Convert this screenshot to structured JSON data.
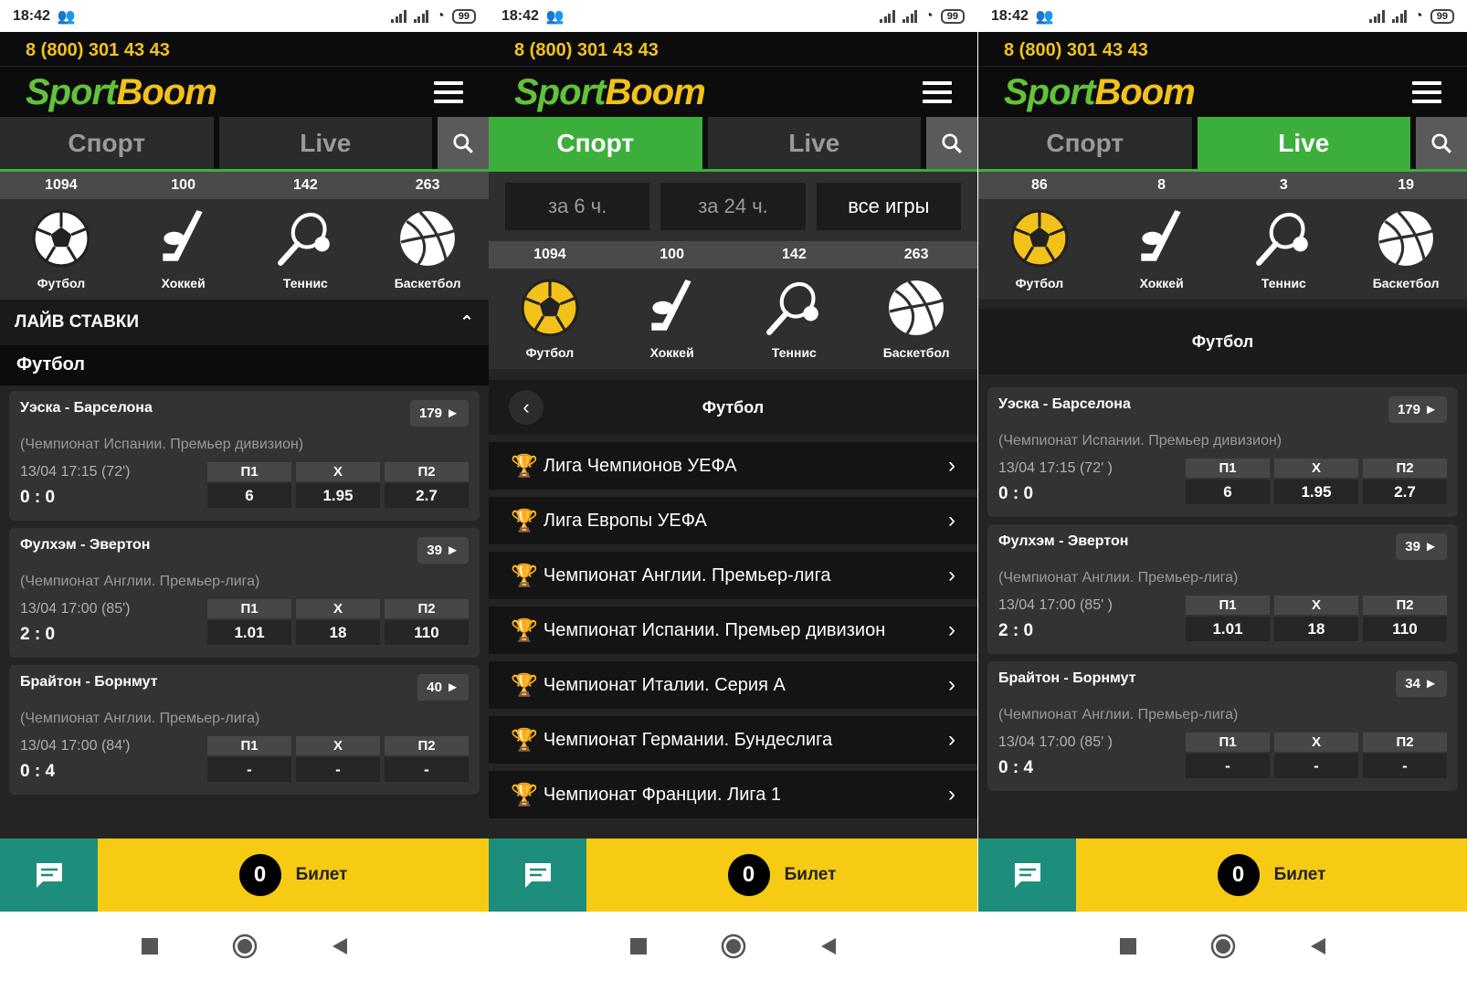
{
  "status": {
    "time": "18:42",
    "battery": "99"
  },
  "header": {
    "phone": "8 (800) 301 43 43",
    "logo_a": "Sport",
    "logo_b": "Boom"
  },
  "tabs": {
    "sport": "Спорт",
    "live": "Live"
  },
  "sports": {
    "labels": [
      "Футбол",
      "Хоккей",
      "Теннис",
      "Баскетбол"
    ],
    "counts_all": [
      "1094",
      "100",
      "142",
      "263"
    ],
    "counts_live": [
      "86",
      "8",
      "3",
      "19"
    ]
  },
  "screen1": {
    "section_title": "ЛАЙВ СТАВКИ",
    "sub_title": "Футбол"
  },
  "screen2": {
    "filters": [
      "за 6 ч.",
      "за 24 ч.",
      "все игры"
    ],
    "back_title": "Футбол",
    "leagues": [
      "Лига Чемпионов УЕФА",
      "Лига Европы УЕФА",
      "Чемпионат Англии. Премьер-лига",
      "Чемпионат Испании. Премьер дивизион",
      "Чемпионат Италии. Серия А",
      "Чемпионат Германии. Бундеслига",
      "Чемпионат Франции. Лига 1"
    ]
  },
  "screen3": {
    "sub_title": "Футбол"
  },
  "odds_labels": [
    "П1",
    "Х",
    "П2"
  ],
  "matches1": [
    {
      "teams": "Уэска - Барселона",
      "count": "179 ►",
      "league": "(Чемпионат Испании. Премьер дивизион)",
      "time": "13/04 17:15 (72')",
      "score": "0 : 0",
      "odds": [
        "6",
        "1.95",
        "2.7"
      ]
    },
    {
      "teams": "Фулхэм - Эвертон",
      "count": "39 ►",
      "league": "(Чемпионат Англии. Премьер-лига)",
      "time": "13/04 17:00 (85')",
      "score": "2 : 0",
      "odds": [
        "1.01",
        "18",
        "110"
      ]
    },
    {
      "teams": "Брайтон - Борнмут",
      "count": "40 ►",
      "league": "(Чемпионат Англии. Премьер-лига)",
      "time": "13/04 17:00 (84')",
      "score": "0 : 4",
      "odds": [
        "-",
        "-",
        "-"
      ]
    }
  ],
  "matches3": [
    {
      "teams": "Уэска - Барселона",
      "count": "179 ►",
      "league": "(Чемпионат Испании. Премьер дивизион)",
      "time": "13/04 17:15 (72' )",
      "score": "0 : 0",
      "odds": [
        "6",
        "1.95",
        "2.7"
      ]
    },
    {
      "teams": "Фулхэм - Эвертон",
      "count": "39 ►",
      "league": "(Чемпионат Англии. Премьер-лига)",
      "time": "13/04 17:00 (85' )",
      "score": "2 : 0",
      "odds": [
        "1.01",
        "18",
        "110"
      ]
    },
    {
      "teams": "Брайтон - Борнмут",
      "count": "34 ►",
      "league": "(Чемпионат Англии. Премьер-лига)",
      "time": "13/04 17:00 (85' )",
      "score": "0 : 4",
      "odds": [
        "-",
        "-",
        "-"
      ]
    }
  ],
  "footer": {
    "count": "0",
    "ticket": "Билет"
  },
  "colors": {
    "green": "#3cae3c",
    "yellow": "#f7cb14",
    "teal": "#1d8d7c"
  }
}
